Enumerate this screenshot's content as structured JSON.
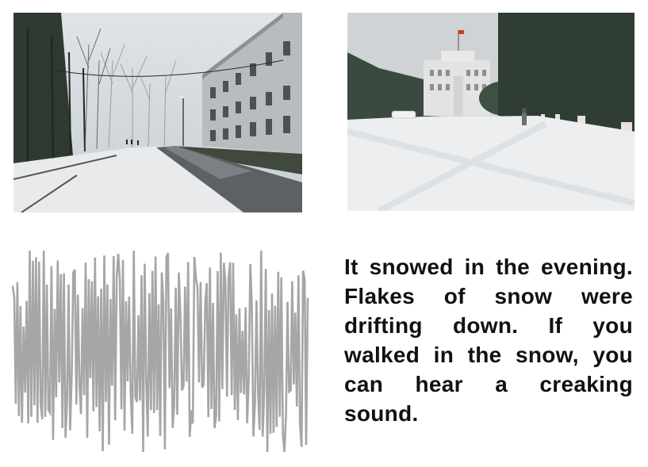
{
  "panels": {
    "street_photo": {
      "subject": "snow-covered street with bare trees and buildings"
    },
    "campus_photo": {
      "subject": "snow-covered plaza with building and evergreen trees"
    },
    "waveform": {
      "color": "#a6a6a8",
      "subject": "sound waveform"
    },
    "caption": {
      "text": "It snowed in the evening. Flakes of snow were drifting down. If you walked in the snow, you can hear a creaking sound."
    }
  }
}
